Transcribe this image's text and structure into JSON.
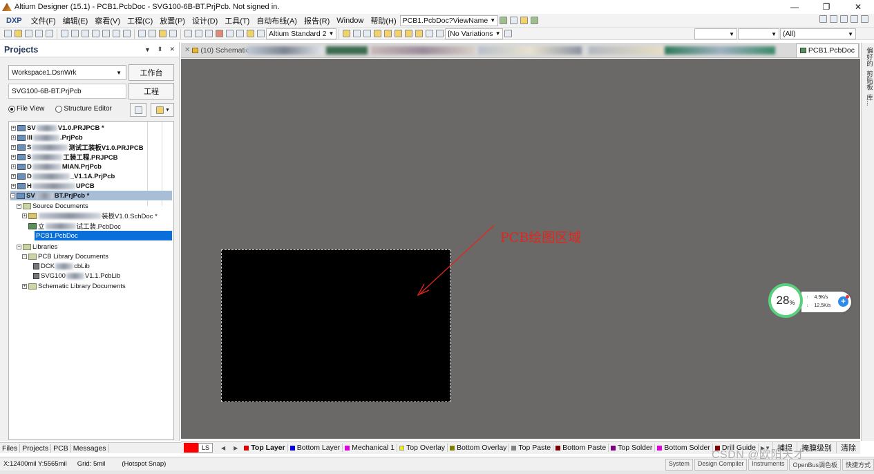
{
  "window": {
    "title": "Altium Designer (15.1) - PCB1.PcbDoc - SVG100-6B-BT.PrjPcb. Not signed in.",
    "controls": [
      "—",
      "❐",
      "✕"
    ]
  },
  "menu": {
    "items": [
      "DXP",
      "文件(F)",
      "编辑(E)",
      "察看(V)",
      "工程(C)",
      "放置(P)",
      "设计(D)",
      "工具(T)",
      "自动布线(A)",
      "报告(R)",
      "Window",
      "帮助(H)"
    ],
    "path_combo": "PCB1.PcbDoc?ViewName"
  },
  "toolbar": {
    "standard_combo": "Altium Standard 2",
    "variations_combo": "[No Variations",
    "filter_combo": "(All)"
  },
  "projects_panel": {
    "title": "Projects",
    "header_icons": [
      "▼",
      "⬍",
      "✕"
    ],
    "workspace": "Workspace1.DsnWrk",
    "workspace_button": "工作台",
    "project": "SVG100-6B-BT.PrjPcb",
    "project_button": "工程",
    "view_file": "File View",
    "view_structure": "Structure Editor",
    "tree": [
      {
        "prefix": "SV",
        "suffix": "V1.0.PRJPCB *",
        "expand": "+"
      },
      {
        "prefix": "III",
        "suffix": ".PrjPcb",
        "expand": "+"
      },
      {
        "prefix": "S",
        "suffix": "测试工装板V1.0.PRJPCB",
        "expand": "+"
      },
      {
        "prefix": "S",
        "suffix": "工装工程.PRJPCB",
        "expand": "+"
      },
      {
        "prefix": "D",
        "suffix": "MIAN.PrjPcb",
        "expand": "+"
      },
      {
        "prefix": "D",
        "suffix": "_V1.1A.PrjPcb",
        "expand": "+"
      },
      {
        "prefix": "H",
        "suffix": "UPCB",
        "expand": "+"
      },
      {
        "prefix": "SV",
        "suffix": "BT.PrjPcb *",
        "expand": "−"
      }
    ],
    "source_documents": "Source Documents",
    "doc_sch": "装板V1.0.SchDoc *",
    "doc_pcb_blurred": "试工装.PcbDoc",
    "doc_pcb1": "PCB1.PcbDoc",
    "prefix_li": "立",
    "libraries": "Libraries",
    "pcb_lib_docs": "PCB Library Documents",
    "lib1_prefix": "DCK",
    "lib1_suffix": "cbLib",
    "lib2_prefix": "SVG100",
    "lib2_suffix": "V1.1.PcbLib",
    "sch_lib_docs": "Schematic Library Documents"
  },
  "bottom_tabs": [
    "Files",
    "Projects",
    "PCB",
    "Messages"
  ],
  "doc_tabs": {
    "first": "(10) Schematic",
    "active": "PCB1.PcbDoc"
  },
  "canvas": {
    "annotation": "PCB绘图区域",
    "background_color": "#6b6868",
    "board_color": "#000000"
  },
  "net_widget": {
    "percent": "28",
    "percent_unit": "%",
    "up": "4.9K/s",
    "down": "12.5K/s",
    "up_arrow": "↑",
    "down_arrow": "↓"
  },
  "right_strip": [
    "偏好的",
    "剪贴板",
    "库..."
  ],
  "layer_bar": {
    "ls": "LS",
    "layers": [
      {
        "name": "Top Layer",
        "color": "#e00000",
        "active": true
      },
      {
        "name": "Bottom Layer",
        "color": "#0000e0"
      },
      {
        "name": "Mechanical 1",
        "color": "#e000e0"
      },
      {
        "name": "Top Overlay",
        "color": "#f0f000"
      },
      {
        "name": "Bottom Overlay",
        "color": "#808000"
      },
      {
        "name": "Top Paste",
        "color": "#808080"
      },
      {
        "name": "Bottom Paste",
        "color": "#800000"
      },
      {
        "name": "Top Solder",
        "color": "#800080"
      },
      {
        "name": "Bottom Solder",
        "color": "#e000e0"
      },
      {
        "name": "Drill Guide",
        "color": "#800000"
      }
    ],
    "capture": "捕捉",
    "mask_level": "掩膜级别",
    "clear": "清除"
  },
  "status_bar": {
    "coords": "X:12400mil Y:5565mil",
    "grid": "Grid: 5mil",
    "snap": "(Hotspot Snap)",
    "right": [
      "System",
      "Design Compiler",
      "Instruments",
      "OpenBus调色板",
      "快捷方式"
    ]
  },
  "watermark": "CSDN @欧阳天才"
}
